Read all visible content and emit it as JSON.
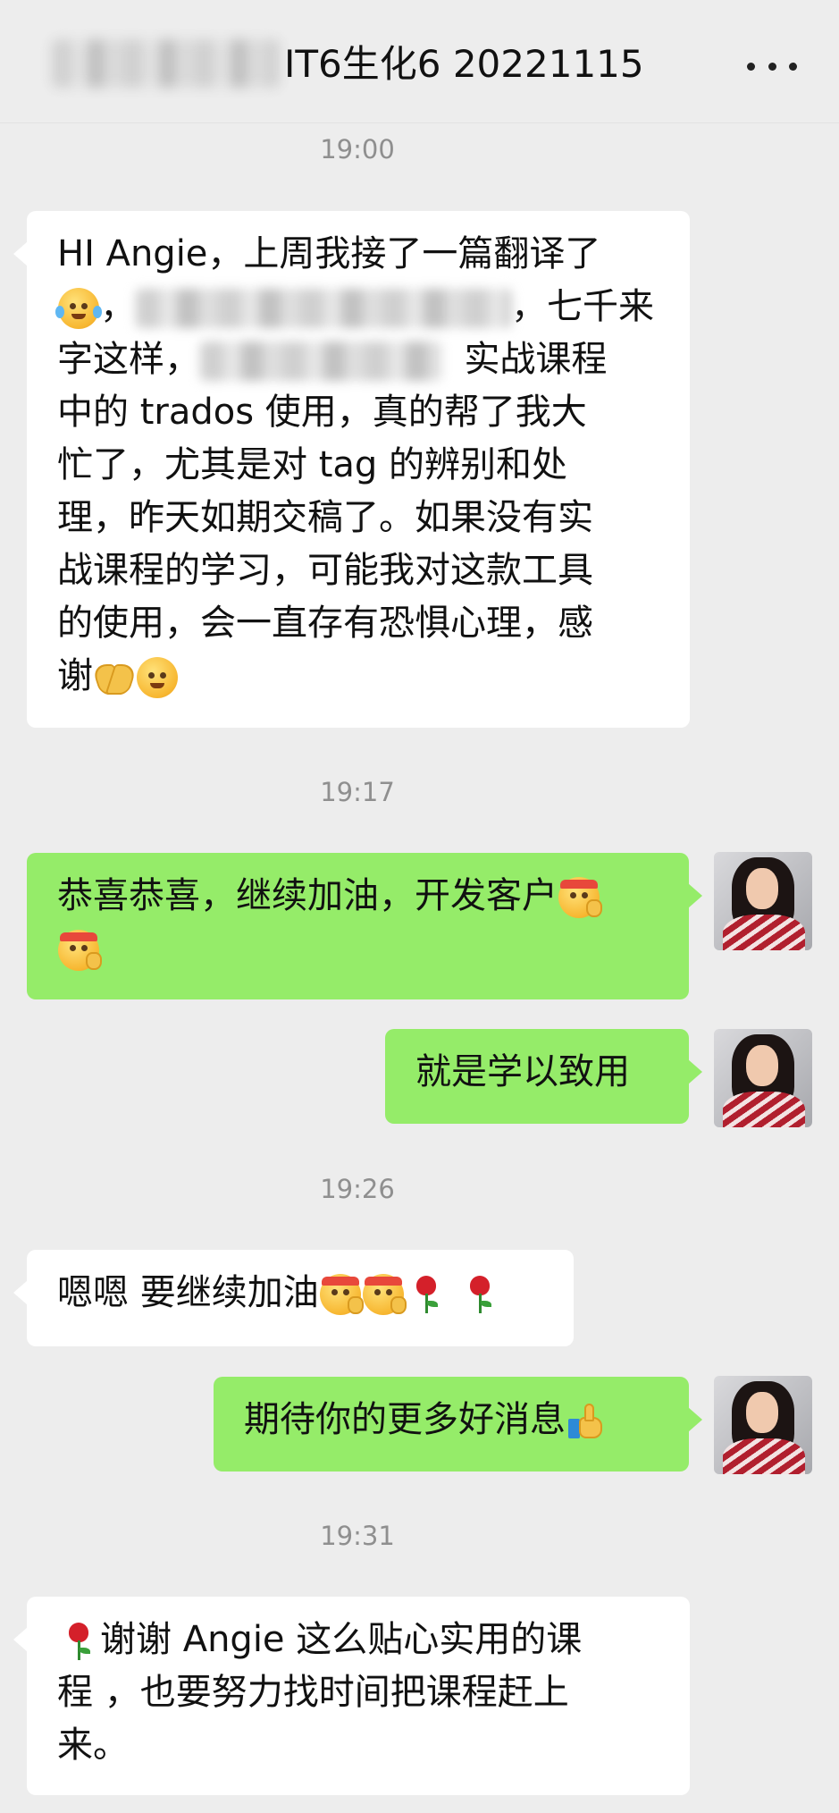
{
  "header": {
    "title": "IT6生化6 20221115",
    "more_icon": "more-horizontal-icon"
  },
  "messages": [
    {
      "type": "time",
      "text": "19:00"
    },
    {
      "type": "incoming",
      "lines": [
        "HI Angie，上周我接了一篇翻译了",
        "，",
        "，七千来",
        "字这样，",
        "实战课程",
        "中的 trados 使用，真的帮了我大",
        "忙了，尤其是对 tag 的辨别和处",
        "理，昨天如期交稿了。如果没有实",
        "战课程的学习，可能我对这款工具",
        "的使用，会一直存有恐惧心理，感",
        "谢"
      ],
      "emojis": [
        "tears-of-joy-emoji",
        "folded-hands-emoji",
        "smiling-face-emoji"
      ]
    },
    {
      "type": "time",
      "text": "19:17"
    },
    {
      "type": "outgoing",
      "lines": [
        "恭喜恭喜，继续加油，开发客户"
      ],
      "emojis": [
        "headband-face-emoji",
        "headband-face-emoji"
      ]
    },
    {
      "type": "outgoing",
      "lines": [
        "就是学以致用"
      ]
    },
    {
      "type": "time",
      "text": "19:26"
    },
    {
      "type": "incoming",
      "lines": [
        "嗯嗯 要继续加油"
      ],
      "emojis": [
        "headband-face-emoji",
        "headband-face-emoji",
        "rose-emoji",
        "rose-emoji"
      ]
    },
    {
      "type": "outgoing",
      "lines": [
        "期待你的更多好消息"
      ],
      "emojis": [
        "thumbs-up-emoji"
      ]
    },
    {
      "type": "time",
      "text": "19:31"
    },
    {
      "type": "incoming",
      "lines": [
        "谢谢 Angie 这么贴心实用的课",
        "程 ，也要努力找时间把课程赶上",
        "来。"
      ],
      "emojis": [
        "rose-emoji"
      ]
    }
  ]
}
